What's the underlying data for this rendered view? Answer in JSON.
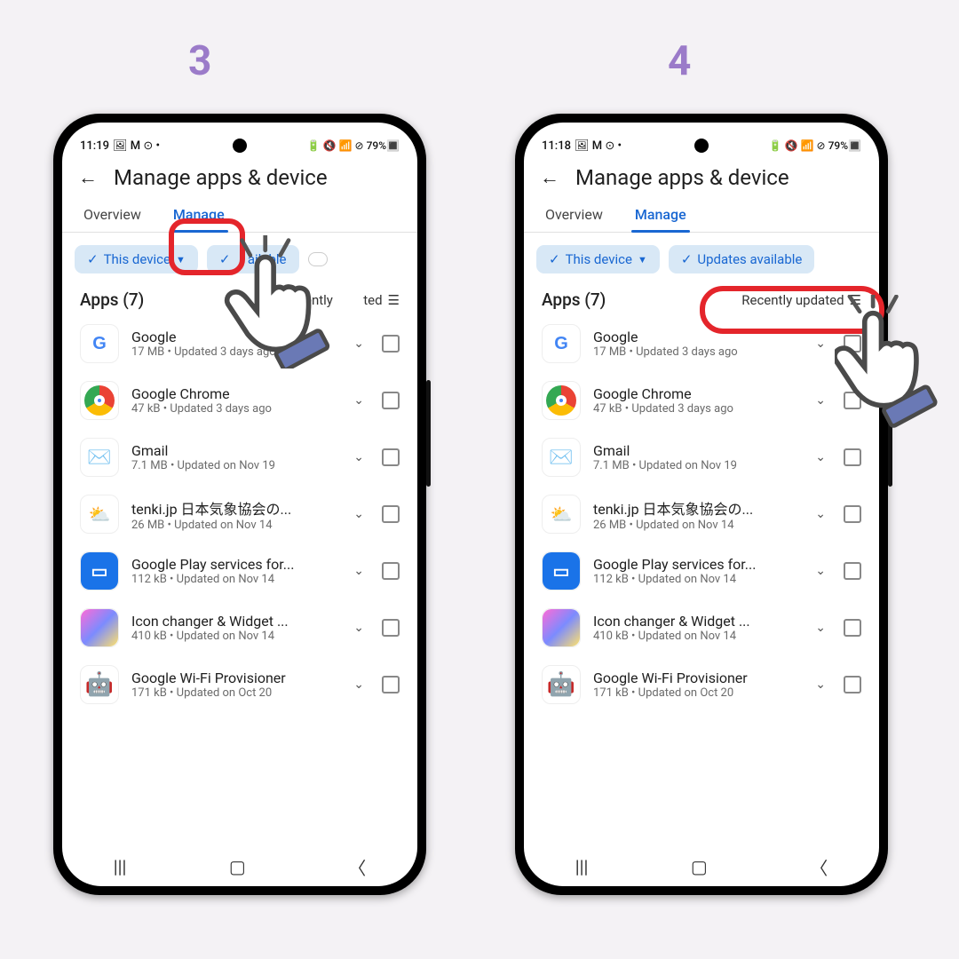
{
  "steps": {
    "left": "3",
    "right": "4"
  },
  "status": {
    "time_left": "11:19",
    "time_right": "11:18",
    "icons_left": "🖼 M ⊙ •",
    "icons_right": "🔋 🔇 📶 ⊘ 79%🔳"
  },
  "header": {
    "title": "Manage apps & device"
  },
  "tabs": {
    "overview": "Overview",
    "manage": "Manage"
  },
  "chips": {
    "device": "This device",
    "updates_full": "Updates available",
    "updates_short": "ailable"
  },
  "list": {
    "count_label": "Apps (7)",
    "sort_label": "Recently updated",
    "sort_label_short": "Recently",
    "sort_label_tail": "ted"
  },
  "apps": [
    {
      "name": "Google",
      "sub": "17 MB  •  Updated 3 days ago"
    },
    {
      "name": "Google Chrome",
      "sub": "47 kB  •  Updated 3 days ago"
    },
    {
      "name": "Gmail",
      "sub": "7.1 MB  •  Updated on Nov 19"
    },
    {
      "name": "tenki.jp 日本気象協会の...",
      "sub": "26 MB  •  Updated on Nov 14"
    },
    {
      "name": "Google Play services for...",
      "sub": "112 kB  •  Updated on Nov 14"
    },
    {
      "name": "Icon changer & Widget ...",
      "sub": "410 kB  •  Updated on Nov 14"
    },
    {
      "name": "Google Wi-Fi Provisioner",
      "sub": "171 kB  •  Updated on Oct 20"
    }
  ],
  "icons": [
    "google",
    "chrome",
    "gmail",
    "tenki",
    "play",
    "iconch",
    "droid"
  ]
}
